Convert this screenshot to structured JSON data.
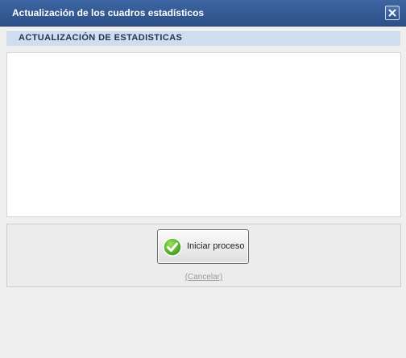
{
  "window": {
    "title": "Actualización de los cuadros estadísticos",
    "close_icon": "close-icon"
  },
  "section": {
    "title": "ACTUALIZACIÓN DE ESTADISTICAS"
  },
  "actions": {
    "start_label": "Iniciar proceso",
    "start_icon": "check-circle-icon",
    "cancel_label": "(Cancelar)"
  },
  "colors": {
    "titlebar": "#2f558f",
    "section_header": "#cfdeef",
    "check_green": "#5cb82e"
  }
}
